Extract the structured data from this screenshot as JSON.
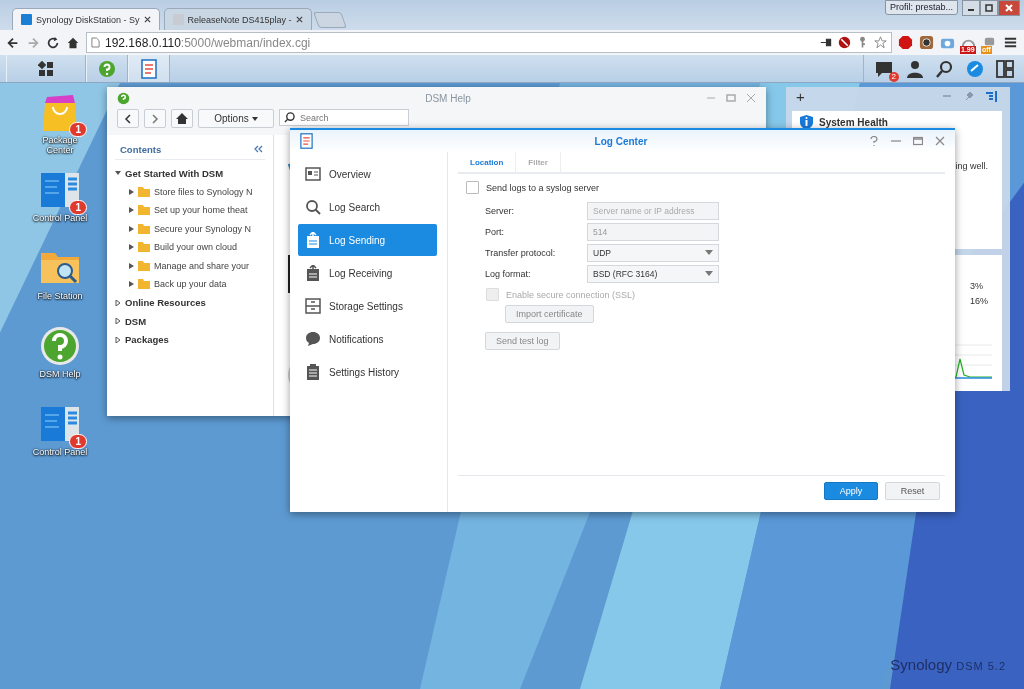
{
  "browser": {
    "tabs": [
      {
        "title": "Synology DiskStation - Sy",
        "selected": true
      },
      {
        "title": "ReleaseNote DS415play -",
        "selected": false
      }
    ],
    "profile": "Profil: prestab...",
    "url_host": "192.168.0.110",
    "url_path": ":5000/webman/index.cgi",
    "speed_badge": "1.99",
    "toggle_badge": "off"
  },
  "taskbar": {
    "notification_count": "2"
  },
  "desktop_icons": [
    {
      "kind": "package",
      "label": "Package Center",
      "badge": "1"
    },
    {
      "kind": "panel",
      "label": "Control Panel",
      "badge": "1"
    },
    {
      "kind": "folder",
      "label": "File Station"
    },
    {
      "kind": "help",
      "label": "DSM Help"
    },
    {
      "kind": "panel",
      "label": "Control Panel",
      "badge": "1"
    }
  ],
  "help_window": {
    "title": "DSM Help",
    "options": "Options",
    "search_placeholder": "Search",
    "contents_title": "Contents",
    "tree": [
      {
        "label": "Get Started With DSM",
        "expanded": true,
        "children": [
          {
            "label": "Store files to Synology N",
            "expanded": false
          },
          {
            "label": "Set up your home theat",
            "expanded": false
          },
          {
            "label": "Secure your Synology N",
            "expanded": false
          },
          {
            "label": "Build your own cloud",
            "expanded": false
          },
          {
            "label": "Manage and share your",
            "expanded": false
          },
          {
            "label": "Back up your data",
            "expanded": false
          }
        ]
      },
      {
        "label": "Online Resources",
        "expanded": false
      },
      {
        "label": "DSM",
        "expanded": false
      },
      {
        "label": "Packages",
        "expanded": false
      }
    ]
  },
  "widget": {
    "add": "+",
    "title": "System Health",
    "status": "ing well.",
    "readings": [
      "3%",
      "16%"
    ]
  },
  "log_center": {
    "title": "Log Center",
    "nav": [
      {
        "label": "Overview",
        "selected": false
      },
      {
        "label": "Log Search",
        "selected": false
      },
      {
        "label": "Log Sending",
        "selected": true
      },
      {
        "label": "Log Receiving",
        "selected": false
      },
      {
        "label": "Storage Settings",
        "selected": false
      },
      {
        "label": "Notifications",
        "selected": false
      },
      {
        "label": "Settings History",
        "selected": false
      }
    ],
    "tabs": [
      {
        "label": "Location",
        "selected": true
      },
      {
        "label": "Filter",
        "selected": false
      }
    ],
    "syslog": {
      "label": "Send logs to a syslog server",
      "checked": false
    },
    "fields": [
      {
        "label": "Server:",
        "kind": "text",
        "placeholder": "Server name or IP address",
        "disabled": true
      },
      {
        "label": "Port:",
        "kind": "text",
        "value": "514",
        "disabled": true
      },
      {
        "label": "Transfer protocol:",
        "kind": "select",
        "value": "UDP",
        "disabled": false
      },
      {
        "label": "Log format:",
        "kind": "select",
        "value": "BSD (RFC 3164)",
        "disabled": false
      }
    ],
    "ssl": {
      "label": "Enable secure connection (SSL)",
      "checked": false,
      "disabled": true
    },
    "import_button": "Import certificate",
    "test_button": "Send test log",
    "apply": "Apply",
    "reset": "Reset"
  },
  "branding": {
    "brand": "Synology",
    "version": "DSM 5.2"
  }
}
